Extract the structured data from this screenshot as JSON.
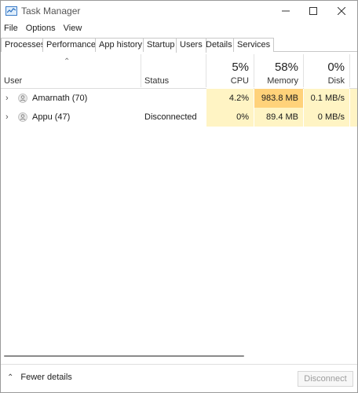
{
  "window": {
    "title": "Task Manager"
  },
  "menu": [
    "File",
    "Options",
    "View"
  ],
  "tabs": [
    "Processes",
    "Performance",
    "App history",
    "Startup",
    "Users",
    "Details",
    "Services"
  ],
  "active_tab": "Users",
  "columns": {
    "user": "User",
    "status": "Status",
    "cpu": {
      "label": "CPU",
      "percent": "5%"
    },
    "memory": {
      "label": "Memory",
      "percent": "58%"
    },
    "disk": {
      "label": "Disk",
      "percent": "0%"
    }
  },
  "rows": [
    {
      "name": "Amarnath (70)",
      "status": "",
      "cpu": "4.2%",
      "memory": "983.8 MB",
      "disk": "0.1 MB/s"
    },
    {
      "name": "Appu (47)",
      "status": "Disconnected",
      "cpu": "0%",
      "memory": "89.4 MB",
      "disk": "0 MB/s"
    }
  ],
  "footer": {
    "fewer_details": "Fewer details",
    "disconnect": "Disconnect"
  },
  "colors": {
    "heat_light": "#fff4c4",
    "heat_medium": "#ffe9a8",
    "heat_strong": "#ffd27a",
    "header_heat_light": "#fff4c4",
    "header_heat_strong": "#ffd27a"
  }
}
